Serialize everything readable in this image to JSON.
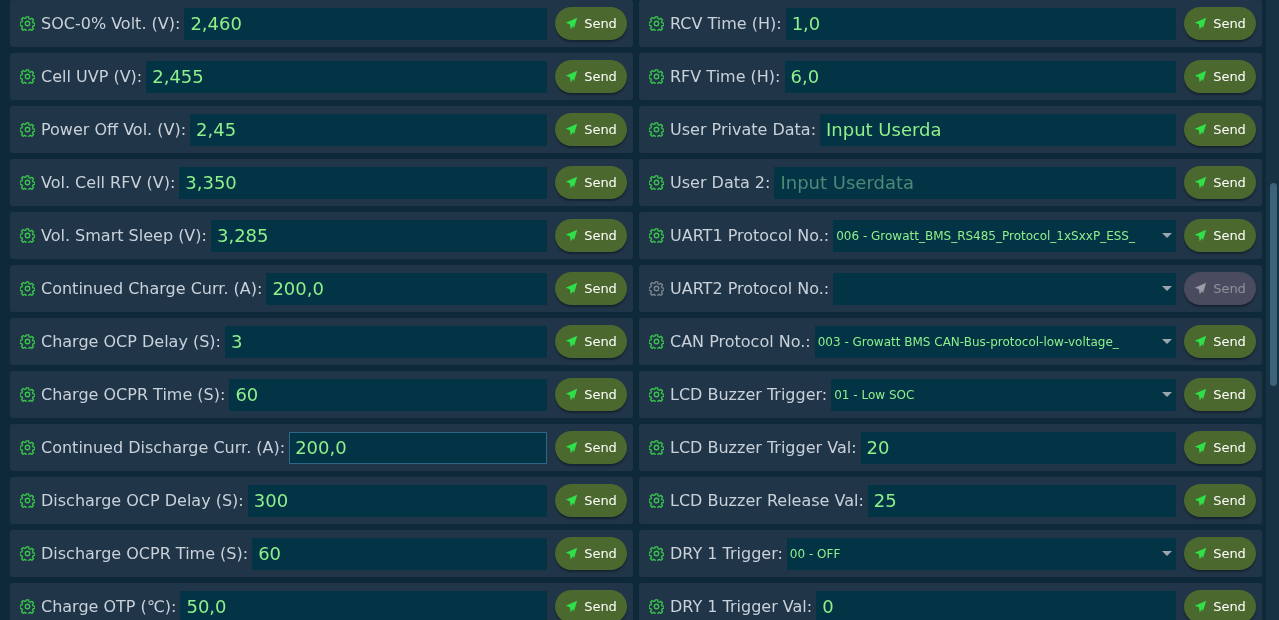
{
  "columns": [
    {
      "rows": [
        {
          "kind": "input",
          "label": "SOC-0% Volt. (V):",
          "value": "2,460",
          "focused": false,
          "disabled": false,
          "button": "Send"
        },
        {
          "kind": "input",
          "label": "Cell UVP (V):",
          "value": "2,455",
          "focused": false,
          "disabled": false,
          "button": "Send"
        },
        {
          "kind": "input",
          "label": "Power Off Vol. (V):",
          "value": "2,45",
          "focused": false,
          "disabled": false,
          "button": "Send"
        },
        {
          "kind": "input",
          "label": "Vol. Cell RFV (V):",
          "value": "3,350",
          "focused": false,
          "disabled": false,
          "button": "Send"
        },
        {
          "kind": "input",
          "label": "Vol. Smart Sleep (V):",
          "value": "3,285",
          "focused": false,
          "disabled": false,
          "button": "Send"
        },
        {
          "kind": "input",
          "label": "Continued Charge Curr. (A):",
          "value": "200,0",
          "focused": false,
          "disabled": false,
          "button": "Send"
        },
        {
          "kind": "input",
          "label": "Charge OCP Delay (S):",
          "value": "3",
          "focused": false,
          "disabled": false,
          "button": "Send"
        },
        {
          "kind": "input",
          "label": "Charge OCPR Time (S):",
          "value": "60",
          "focused": false,
          "disabled": false,
          "button": "Send"
        },
        {
          "kind": "input",
          "label": "Continued Discharge Curr. (A):",
          "value": "200,0",
          "focused": true,
          "disabled": false,
          "button": "Send"
        },
        {
          "kind": "input",
          "label": "Discharge OCP Delay (S):",
          "value": "300",
          "focused": false,
          "disabled": false,
          "button": "Send"
        },
        {
          "kind": "input",
          "label": "Discharge OCPR Time (S):",
          "value": "60",
          "focused": false,
          "disabled": false,
          "button": "Send"
        },
        {
          "kind": "input",
          "label": "Charge OTP (℃):",
          "value": "50,0",
          "focused": false,
          "disabled": false,
          "button": "Send"
        }
      ]
    },
    {
      "rows": [
        {
          "kind": "input",
          "label": "RCV Time (H):",
          "value": "1,0",
          "focused": false,
          "disabled": false,
          "button": "Send"
        },
        {
          "kind": "input",
          "label": "RFV Time (H):",
          "value": "6,0",
          "focused": false,
          "disabled": false,
          "button": "Send"
        },
        {
          "kind": "input",
          "label": "User Private Data:",
          "value": "Input Userda",
          "focused": false,
          "disabled": false,
          "button": "Send"
        },
        {
          "kind": "input",
          "label": "User Data 2:",
          "placeholder": "Input Userdata",
          "focused": false,
          "disabled": false,
          "button": "Send"
        },
        {
          "kind": "select",
          "label": "UART1 Protocol No.:",
          "value": "006 - Growatt_BMS_RS485_Protocol_1xSxxP_ESS_",
          "focused": false,
          "disabled": false,
          "button": "Send"
        },
        {
          "kind": "select",
          "label": "UART2 Protocol No.:",
          "focused": false,
          "disabled": true,
          "button": "Send"
        },
        {
          "kind": "select",
          "label": "CAN Protocol No.:",
          "value": "003 - Growatt BMS CAN-Bus-protocol-low-voltage_",
          "focused": false,
          "disabled": false,
          "button": "Send"
        },
        {
          "kind": "select",
          "label": "LCD Buzzer Trigger:",
          "value": "01 - Low SOC",
          "focused": false,
          "disabled": false,
          "button": "Send"
        },
        {
          "kind": "input",
          "label": "LCD Buzzer Trigger Val:",
          "value": "20",
          "focused": false,
          "disabled": false,
          "button": "Send"
        },
        {
          "kind": "input",
          "label": "LCD Buzzer Release Val:",
          "value": "25",
          "focused": false,
          "disabled": false,
          "button": "Send"
        },
        {
          "kind": "select",
          "label": "DRY 1 Trigger:",
          "value": "00 - OFF",
          "focused": false,
          "disabled": false,
          "button": "Send"
        },
        {
          "kind": "input",
          "label": "DRY 1 Trigger Val:",
          "value": "0",
          "focused": false,
          "disabled": false,
          "button": "Send"
        }
      ]
    }
  ]
}
